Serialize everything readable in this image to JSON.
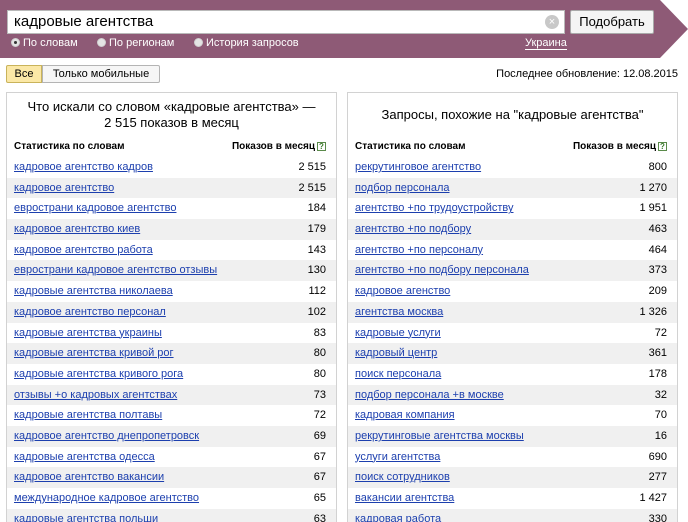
{
  "search": {
    "value": "кадровые агентства",
    "button_label": "Подобрать",
    "clear_glyph": "×"
  },
  "modes": [
    {
      "label": "По словам",
      "selected": true
    },
    {
      "label": "По регионам",
      "selected": false
    },
    {
      "label": "История запросов",
      "selected": false
    }
  ],
  "region": "Украина",
  "filters": {
    "all": "Все",
    "mobile": "Только мобильные"
  },
  "last_update": "Последнее обновление: 12.08.2015",
  "left_panel": {
    "title": "Что искали со словом «кадровые агентства» — 2 515 показов в месяц",
    "col_phrase": "Статистика по словам",
    "col_count": "Показов в месяц",
    "help_glyph": "?",
    "rows": [
      {
        "phrase": "кадровое агентство кадров",
        "count": "2 515"
      },
      {
        "phrase": "кадровое агентство",
        "count": "2 515"
      },
      {
        "phrase": "евространи кадровое агентство",
        "count": "184"
      },
      {
        "phrase": "кадровое агентство киев",
        "count": "179"
      },
      {
        "phrase": "кадровое агентство работа",
        "count": "143"
      },
      {
        "phrase": "евространи кадровое агентство отзывы",
        "count": "130"
      },
      {
        "phrase": "кадровые агентства николаева",
        "count": "112"
      },
      {
        "phrase": "кадровое агентство персонал",
        "count": "102"
      },
      {
        "phrase": "кадровые агентства украины",
        "count": "83"
      },
      {
        "phrase": "кадровые агентства кривой рог",
        "count": "80"
      },
      {
        "phrase": "кадровые агентства кривого рога",
        "count": "80"
      },
      {
        "phrase": "отзывы +о кадровых агентствах",
        "count": "73"
      },
      {
        "phrase": "кадровые агентства полтавы",
        "count": "72"
      },
      {
        "phrase": "кадровое агентство днепропетровск",
        "count": "69"
      },
      {
        "phrase": "кадровые агентства одесса",
        "count": "67"
      },
      {
        "phrase": "кадровое агентство вакансии",
        "count": "67"
      },
      {
        "phrase": "международное кадровое агентство",
        "count": "65"
      },
      {
        "phrase": "кадровые агентства польши",
        "count": "63"
      }
    ]
  },
  "right_panel": {
    "title": "Запросы, похожие на \"кадровые агентства\"",
    "col_phrase": "Статистика по словам",
    "col_count": "Показов в месяц",
    "help_glyph": "?",
    "rows": [
      {
        "phrase": "рекрутинговое агентство",
        "count": "800"
      },
      {
        "phrase": "подбор персонала",
        "count": "1 270"
      },
      {
        "phrase": "агентство +по трудоустройству",
        "count": "1 951"
      },
      {
        "phrase": "агентство +по подбору",
        "count": "463"
      },
      {
        "phrase": "агентство +по персоналу",
        "count": "464"
      },
      {
        "phrase": "агентство +по подбору персонала",
        "count": "373"
      },
      {
        "phrase": "кадровое агенство",
        "count": "209"
      },
      {
        "phrase": "агентства москва",
        "count": "1 326"
      },
      {
        "phrase": "кадровые услуги",
        "count": "72"
      },
      {
        "phrase": "кадровый центр",
        "count": "361"
      },
      {
        "phrase": "поиск персонала",
        "count": "178"
      },
      {
        "phrase": "подбор персонала +в москве",
        "count": "32"
      },
      {
        "phrase": "кадровая компания",
        "count": "70"
      },
      {
        "phrase": "рекрутинговые агентства москвы",
        "count": "16"
      },
      {
        "phrase": "услуги агентства",
        "count": "690"
      },
      {
        "phrase": "поиск сотрудников",
        "count": "277"
      },
      {
        "phrase": "вакансии агентства",
        "count": "1 427"
      },
      {
        "phrase": "кадровая работа",
        "count": "330"
      }
    ]
  }
}
